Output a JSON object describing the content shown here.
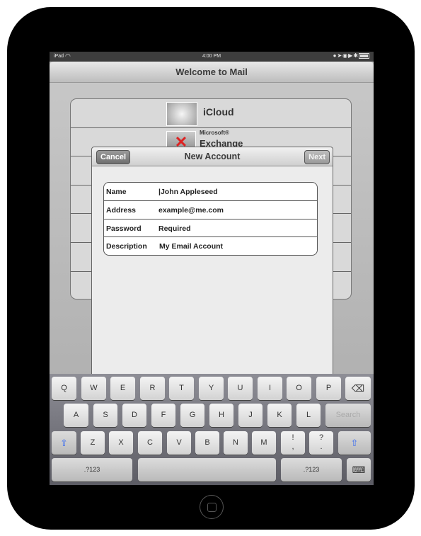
{
  "status_bar": {
    "carrier": "iPad",
    "time": "4:00 PM",
    "icons": [
      "wifi-icon",
      "clock-icon",
      "location-icon",
      "rotation-lock-icon",
      "play-icon",
      "bluetooth-icon",
      "battery-icon"
    ]
  },
  "navbar": {
    "title": "Welcome to Mail"
  },
  "providers": [
    {
      "label": "iCloud",
      "icon": "icloud-icon"
    },
    {
      "label_small": "Microsoft®",
      "label": "Exchange",
      "icon": "exchange-icon"
    }
  ],
  "modal": {
    "title": "New Account",
    "cancel_label": "Cancel",
    "next_label": "Next",
    "fields": [
      {
        "label": "Name",
        "value": "|John Appleseed"
      },
      {
        "label": "Address",
        "value": "example@me.com"
      },
      {
        "label": "Password",
        "value": "Required"
      },
      {
        "label": "Description",
        "value": "My Email Account"
      }
    ]
  },
  "keyboard": {
    "row1": [
      "Q",
      "W",
      "E",
      "R",
      "T",
      "Y",
      "U",
      "I",
      "O",
      "P"
    ],
    "delete": "⌫",
    "row2": [
      "A",
      "S",
      "D",
      "F",
      "G",
      "H",
      "J",
      "K",
      "L"
    ],
    "search": "Search",
    "shift": "⇧",
    "row3": [
      "Z",
      "X",
      "C",
      "V",
      "B",
      "N",
      "M"
    ],
    "punct1": "!\n,",
    "punct2": "?\n.",
    "numbers": ".?123",
    "hide": "⌨"
  }
}
